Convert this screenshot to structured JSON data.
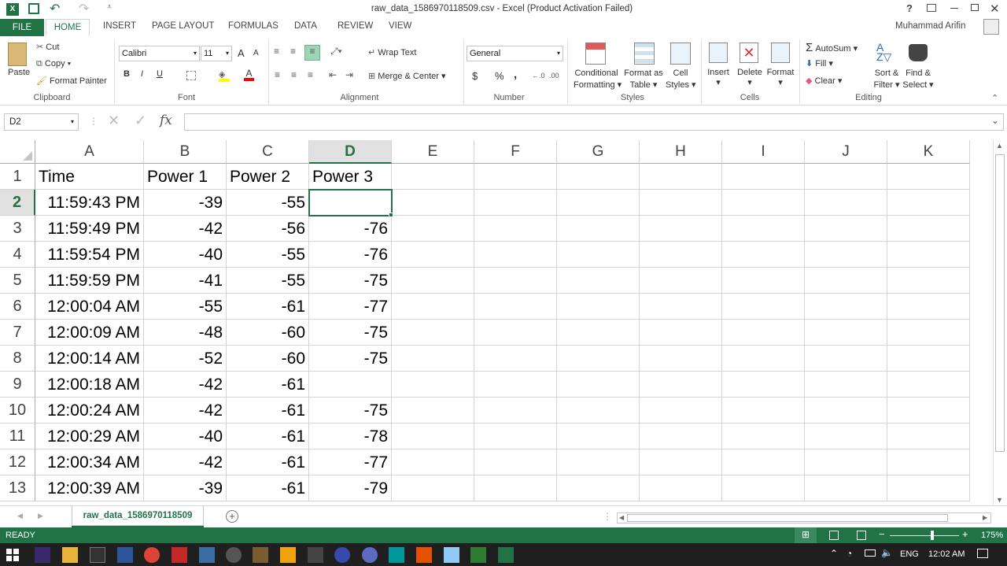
{
  "window": {
    "title": "raw_data_1586970118509.csv - Excel (Product Activation Failed)",
    "help": "?"
  },
  "ribbon_tabs": [
    "FILE",
    "HOME",
    "INSERT",
    "PAGE LAYOUT",
    "FORMULAS",
    "DATA",
    "REVIEW",
    "VIEW"
  ],
  "user": "Muhammad Arifin",
  "clipboard": {
    "paste": "Paste",
    "cut": "Cut",
    "copy": "Copy",
    "format_painter": "Format Painter",
    "label": "Clipboard"
  },
  "font": {
    "name": "Calibri",
    "size": "11",
    "grow": "A",
    "shrink": "A",
    "bold": "B",
    "italic": "I",
    "underline": "U",
    "label": "Font"
  },
  "alignment": {
    "wrap": "Wrap Text",
    "merge": "Merge & Center",
    "label": "Alignment"
  },
  "number": {
    "format": "General",
    "currency": "$",
    "percent": "%",
    "comma": ",",
    "label": "Number"
  },
  "styles": {
    "conditional": "Conditional",
    "conditional2": "Formatting",
    "format_as": "Format as",
    "format_as2": "Table",
    "cell_styles": "Cell",
    "cell_styles2": "Styles",
    "label": "Styles"
  },
  "cells": {
    "insert": "Insert",
    "delete": "Delete",
    "format": "Format",
    "label": "Cells"
  },
  "editing": {
    "autosum": "AutoSum",
    "fill": "Fill",
    "clear": "Clear",
    "sort": "Sort &",
    "sort2": "Filter",
    "find": "Find &",
    "find2": "Select",
    "label": "Editing"
  },
  "formula_bar": {
    "name_box": "D2",
    "fx": "fx",
    "value": ""
  },
  "columns": [
    "A",
    "B",
    "C",
    "D",
    "E",
    "F",
    "G",
    "H",
    "I",
    "J",
    "K"
  ],
  "rows": [
    {
      "n": "1",
      "a": "Time",
      "b": "Power 1",
      "c": "Power 2",
      "d": "Power 3"
    },
    {
      "n": "2",
      "a": "11:59:43 PM",
      "b": "-39",
      "c": "-55",
      "d": ""
    },
    {
      "n": "3",
      "a": "11:59:49 PM",
      "b": "-42",
      "c": "-56",
      "d": "-76"
    },
    {
      "n": "4",
      "a": "11:59:54 PM",
      "b": "-40",
      "c": "-55",
      "d": "-76"
    },
    {
      "n": "5",
      "a": "11:59:59 PM",
      "b": "-41",
      "c": "-55",
      "d": "-75"
    },
    {
      "n": "6",
      "a": "12:00:04 AM",
      "b": "-55",
      "c": "-61",
      "d": "-77"
    },
    {
      "n": "7",
      "a": "12:00:09 AM",
      "b": "-48",
      "c": "-60",
      "d": "-75"
    },
    {
      "n": "8",
      "a": "12:00:14 AM",
      "b": "-52",
      "c": "-60",
      "d": "-75"
    },
    {
      "n": "9",
      "a": "12:00:18 AM",
      "b": "-42",
      "c": "-61",
      "d": ""
    },
    {
      "n": "10",
      "a": "12:00:24 AM",
      "b": "-42",
      "c": "-61",
      "d": "-75"
    },
    {
      "n": "11",
      "a": "12:00:29 AM",
      "b": "-40",
      "c": "-61",
      "d": "-78"
    },
    {
      "n": "12",
      "a": "12:00:34 AM",
      "b": "-42",
      "c": "-61",
      "d": "-77"
    },
    {
      "n": "13",
      "a": "12:00:39 AM",
      "b": "-39",
      "c": "-61",
      "d": "-79"
    }
  ],
  "sheet_tab": "raw_data_1586970118509",
  "status": {
    "ready": "READY",
    "zoom": "175%"
  },
  "taskbar": {
    "lang": "ENG",
    "time": "12:02 AM"
  },
  "colors": {
    "excel_green": "#217346",
    "selection": "#217346"
  }
}
